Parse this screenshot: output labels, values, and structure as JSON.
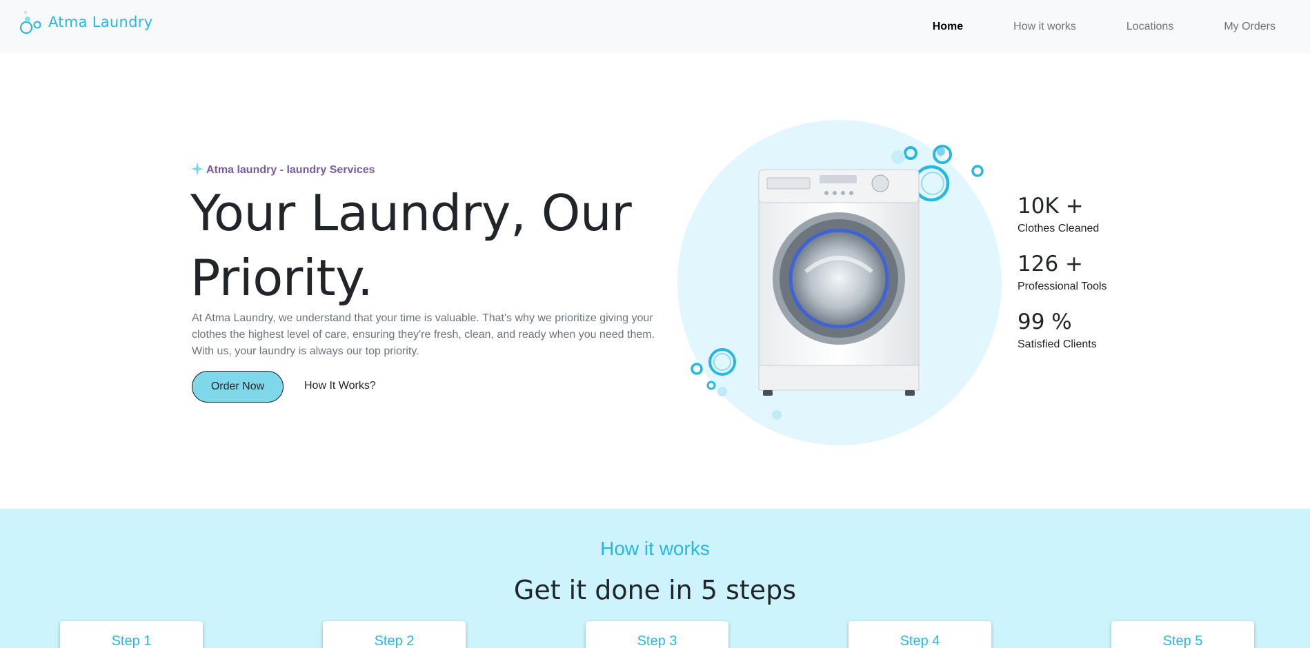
{
  "nav": {
    "brand": "Atma Laundry",
    "links": [
      {
        "label": "Home",
        "active": true
      },
      {
        "label": "How it works",
        "active": false
      },
      {
        "label": "Locations",
        "active": false
      },
      {
        "label": "My Orders",
        "active": false
      }
    ]
  },
  "hero": {
    "tagline": "Atma laundry - laundry Services",
    "title_line1": "Your Laundry, Our",
    "title_line2": "Priority.",
    "description": "At Atma Laundry, we understand that your time is valuable. That's why we prioritize giving your clothes the highest level of care, ensuring they're fresh, clean, and ready when you need them. With us, your laundry is always our top priority.",
    "order_button": "Order Now",
    "how_link": "How It Works?",
    "image_icon": "washing-machine-icon"
  },
  "stats": [
    {
      "value": "10K +",
      "label": "Clothes Cleaned"
    },
    {
      "value": "126 +",
      "label": "Professional Tools"
    },
    {
      "value": "99 %",
      "label": "Satisfied Clients"
    }
  ],
  "how": {
    "kicker": "How it works",
    "title": "Get it done in 5 steps",
    "steps": [
      {
        "title": "Step 1"
      },
      {
        "title": "Step 2"
      },
      {
        "title": "Step 3"
      },
      {
        "title": "Step 4"
      },
      {
        "title": "Step 5"
      }
    ]
  },
  "colors": {
    "brand": "#29b6df",
    "accent_button": "#7fd7ea",
    "tagline": "#7a5c9e",
    "section_bg": "#cdf4fc",
    "hero_circle": "#e1f7fd"
  }
}
